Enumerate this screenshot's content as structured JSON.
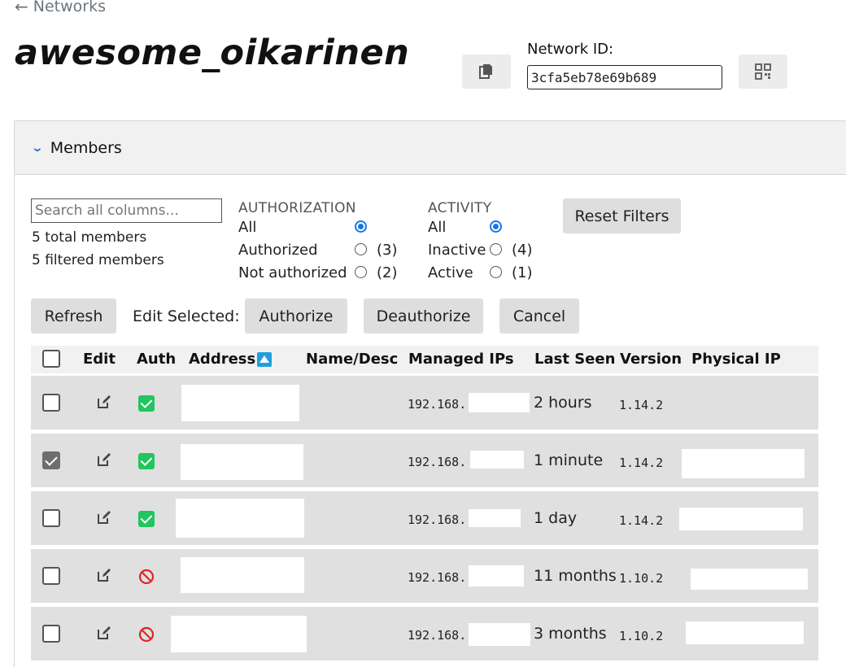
{
  "nav": {
    "back_label": "Networks"
  },
  "network": {
    "name": "awesome_oikarinen",
    "id_label": "Network ID:",
    "id_value": "3cfa5eb78e69b689"
  },
  "panel": {
    "title": "Members"
  },
  "filters": {
    "search_placeholder": "Search all columns...",
    "total_text": "5 total members",
    "filtered_text": "5 filtered members",
    "authorization": {
      "heading": "AUTHORIZATION",
      "options": [
        {
          "label": "All",
          "count": "",
          "selected": true
        },
        {
          "label": "Authorized",
          "count": "(3)",
          "selected": false
        },
        {
          "label": "Not authorized",
          "count": "(2)",
          "selected": false
        }
      ]
    },
    "activity": {
      "heading": "ACTIVITY",
      "options": [
        {
          "label": "All",
          "count": "",
          "selected": true
        },
        {
          "label": "Inactive",
          "count": "(4)",
          "selected": false
        },
        {
          "label": "Active",
          "count": "(1)",
          "selected": false
        }
      ]
    },
    "reset_label": "Reset Filters"
  },
  "actions": {
    "refresh": "Refresh",
    "edit_selected": "Edit Selected:",
    "authorize": "Authorize",
    "deauthorize": "Deauthorize",
    "cancel": "Cancel"
  },
  "table": {
    "columns": [
      "Edit",
      "Auth",
      "Address",
      "Name/Desc",
      "Managed IPs",
      "Last Seen",
      "Version",
      "Physical IP"
    ],
    "rows": [
      {
        "selected": false,
        "authorized": true,
        "ip": "192.168.",
        "last_seen": "2 hours",
        "version": "1.14.2"
      },
      {
        "selected": true,
        "authorized": true,
        "ip": "192.168.",
        "last_seen": "1 minute",
        "version": "1.14.2"
      },
      {
        "selected": false,
        "authorized": true,
        "ip": "192.168.",
        "last_seen": "1 day",
        "version": "1.14.2"
      },
      {
        "selected": false,
        "authorized": false,
        "ip": "192.168.",
        "last_seen": "11 months",
        "version": "1.10.2"
      },
      {
        "selected": false,
        "authorized": false,
        "ip": "192.168.",
        "last_seen": "3 months",
        "version": "1.10.2"
      }
    ]
  },
  "colors": {
    "accent": "#1b74e8",
    "authorized": "#22c55e",
    "unauthorized": "#e02424",
    "row_bg": "#e0e0e0"
  }
}
